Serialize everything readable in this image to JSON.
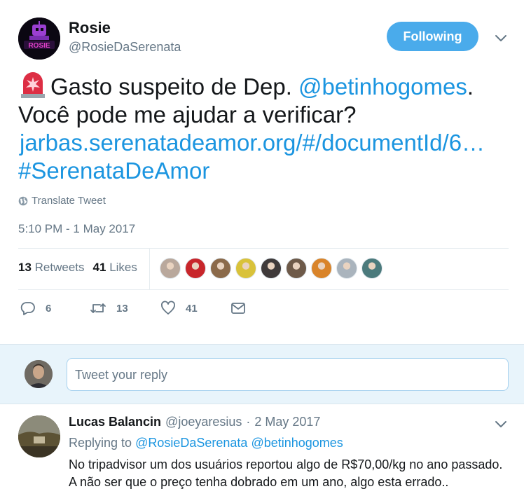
{
  "tweet": {
    "author_name": "Rosie",
    "author_handle": "@RosieDaSerenata",
    "avatar_text": "ROSIE",
    "follow_label": "Following",
    "text_part1": "Gasto suspeito de Dep. ",
    "mention": "@betinhogomes",
    "text_part2": ". Você pode me ajudar a verificar?",
    "url": "jarbas.serenatadeamor.org/#/documentId/6…",
    "hashtag": "#SerenataDeAmor",
    "translate_label": "Translate Tweet",
    "timestamp": "5:10 PM - 1 May 2017",
    "retweet_count": "13",
    "retweet_label": "Retweets",
    "like_count": "41",
    "like_label": "Likes"
  },
  "likers": [
    {
      "color": "#b9a89c"
    },
    {
      "color": "#c8262b"
    },
    {
      "color": "#8b6a4a"
    },
    {
      "color": "#d9c23a"
    },
    {
      "color": "#3f3a3a"
    },
    {
      "color": "#6e5a49"
    },
    {
      "color": "#d9842a"
    },
    {
      "color": "#aab4bd"
    },
    {
      "color": "#4b7a7c"
    }
  ],
  "actions": {
    "reply_count": "6",
    "retweet_count": "13",
    "like_count": "41"
  },
  "reply_box": {
    "placeholder": "Tweet your reply"
  },
  "reply": {
    "name": "Lucas Balancin",
    "handle": "@joeyaresius",
    "separator": "·",
    "date": "2 May 2017",
    "replying_prefix": "Replying to",
    "replying_to_1": "@RosieDaSerenata",
    "replying_to_2": "@betinhogomes",
    "text": "No tripadvisor um dos usuários reportou algo de R$70,00/kg no ano passado. A não ser que o preço tenha dobrado em um ano, algo esta errado.."
  },
  "colors": {
    "link": "#1b95e0",
    "follow_button": "#4aabeb",
    "muted": "#657786",
    "reply_area": "#e8f4fb"
  }
}
